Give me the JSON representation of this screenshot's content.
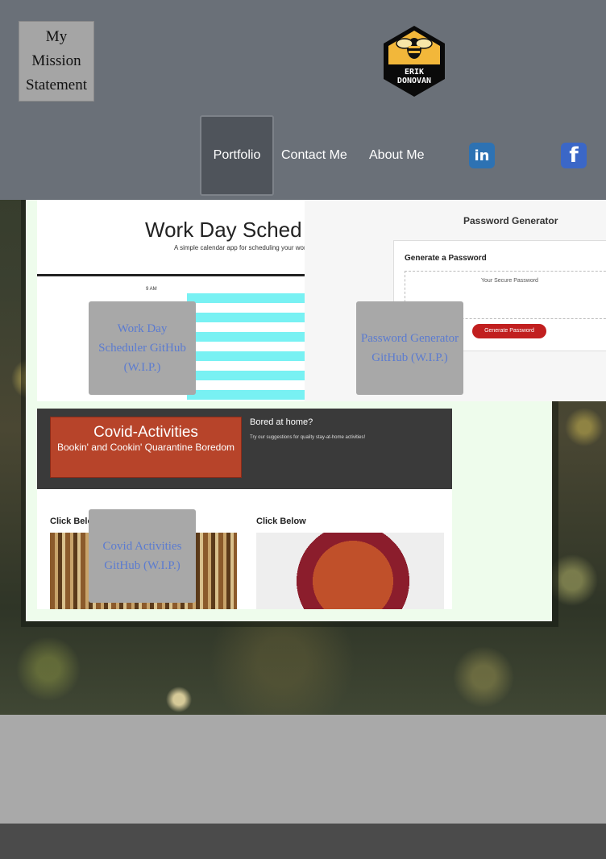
{
  "header": {
    "mission_statement": "My Mission Statement",
    "logo_text_line1": "ERIK",
    "logo_text_line2": "DONOVAN",
    "nav": {
      "portfolio": "Portfolio",
      "contact": "Contact Me",
      "about": "About Me"
    },
    "social": {
      "linkedin": "in",
      "facebook": "f"
    }
  },
  "projects": [
    {
      "label": "Work Day Scheduler GitHub (W.I.P.)",
      "screenshot": {
        "title": "Work Day Sched",
        "subtitle": "A simple calendar app for scheduling your work",
        "time": "9 AM"
      }
    },
    {
      "label": "Password Generator GitHub (W.I.P.)",
      "screenshot": {
        "title": "Password Generator",
        "heading": "Generate a Password",
        "placeholder": "Your Secure Password",
        "button": "Generate Password"
      }
    },
    {
      "label": "Covid Activities GitHub (W.I.P.)",
      "screenshot": {
        "title": "Covid-Activities",
        "subtitle": "Bookin' and Cookin' Quarantine Boredom",
        "bored": "Bored at home?",
        "tagline": "Try our suggestions for quality stay-at-home activities!",
        "click1": "Click Below",
        "click2": "Click Below"
      }
    }
  ],
  "colors": {
    "header_bg": "#6a7078",
    "label_text": "#5b7bd0",
    "panel_bg": "#eefcec",
    "footer_bg": "#4b4b4b"
  }
}
